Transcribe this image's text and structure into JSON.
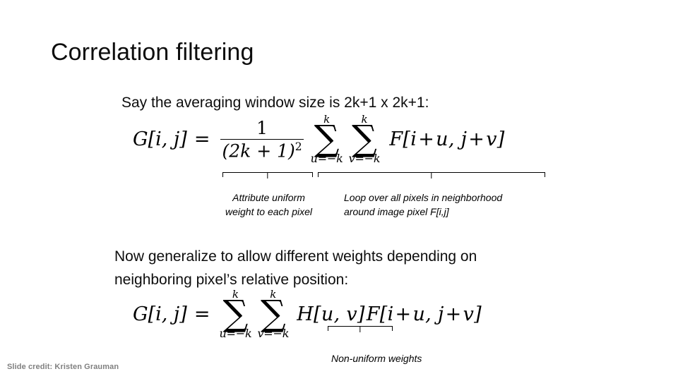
{
  "slide": {
    "title": "Correlation filtering",
    "background_color": "#ffffff",
    "text_color": "#0d0d0d"
  },
  "body": {
    "intro_line": "Say the averaging window size is 2k+1 x 2k+1:",
    "generalize_line_1": "Now generalize to allow different weights depending on",
    "generalize_line_2": "neighboring pixel’s relative position:"
  },
  "formula_1": {
    "lhs": "G[i, j]",
    "equals": "=",
    "fraction_numerator": "1",
    "fraction_denominator": "(2k + 1)",
    "fraction_denominator_exponent": "2",
    "sum_1": {
      "top": "k",
      "bottom": "u=−k",
      "symbol": "∑"
    },
    "sum_2": {
      "top": "k",
      "bottom": "v=−k",
      "symbol": "∑"
    },
    "operand_prefix": "F[i",
    "operand_plus_1": "+",
    "operand_u": "u, j",
    "operand_plus_2": "+",
    "operand_v": "v]"
  },
  "formula_2": {
    "lhs": "G[i, j]",
    "equals": "=",
    "sum_1": {
      "top": "k",
      "bottom": "u=−k",
      "symbol": "∑"
    },
    "sum_2": {
      "top": "k",
      "bottom": "v=−k",
      "symbol": "∑"
    },
    "kernel": "H[u, v]",
    "operand_prefix": "F[i",
    "operand_plus_1": "+",
    "operand_u": "u, j",
    "operand_plus_2": "+",
    "operand_v": "v]"
  },
  "annotations": {
    "uniform_line_1": "Attribute uniform",
    "uniform_line_2": "weight to each pixel",
    "loop_line_1": "Loop over all pixels in neighborhood",
    "loop_line_2": "around  image pixel F[i,j]",
    "nonuniform": "Non-uniform weights"
  },
  "footer": {
    "credit": "Slide credit: Kristen Grauman",
    "credit_color": "#808080"
  }
}
